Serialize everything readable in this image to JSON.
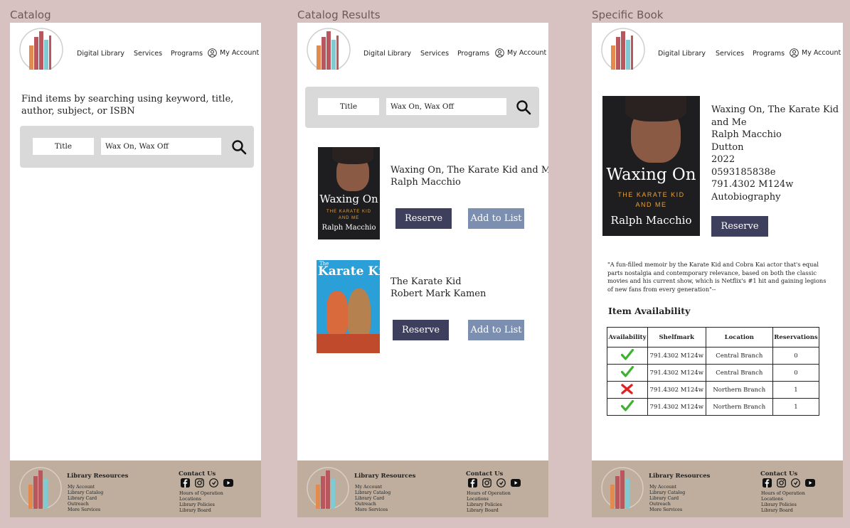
{
  "frames": {
    "catalog": "Catalog",
    "results": "Catalog Results",
    "book": "Specific Book"
  },
  "nav": {
    "digital_library": "Digital Library",
    "services": "Services",
    "programs": "Programs",
    "my_account": "My Account"
  },
  "search": {
    "intro": "Find items by searching using keyword, title, author, subject, or ISBN",
    "type": "Title",
    "query": "Wax On, Wax Off"
  },
  "results": [
    {
      "title": "Waxing On, The Karate Kid and Me",
      "author": "Ralph Macchio",
      "reserve": "Reserve",
      "add": "Add to List"
    },
    {
      "title": "The Karate Kid",
      "author": "Robert Mark Kamen",
      "reserve": "Reserve",
      "add": "Add to List"
    }
  ],
  "covers": {
    "waxing_title": "Waxing On",
    "waxing_sub1": "THE KARATE KID",
    "waxing_sub2": "AND ME",
    "waxing_author": "Ralph Macchio",
    "karate_the": "The",
    "karate_title": "Karate Kid"
  },
  "book": {
    "title_line1": "Waxing On, The Karate Kid",
    "title_line2": "and Me",
    "author": "Ralph Macchio",
    "publisher": "Dutton",
    "year": "2022",
    "isbn": "0593185838e",
    "call_number": "791.4302 M124w",
    "genre": "Autobiography",
    "reserve": "Reserve",
    "description": "\"A fun-filled memoir by the Karate Kid and Cobra Kai actor that's equal parts nostalgia and contemporary relevance, based on both the classic movies and his current show, which is Netflix's #1 hit and gaining legions of new fans from every generation\"--",
    "availability_heading": "Item Availability",
    "table": {
      "headers": [
        "Availability",
        "Shelfmark",
        "Location",
        "Reservations"
      ],
      "rows": [
        {
          "status": "available",
          "shelfmark": "791.4302 M124w",
          "location": "Central Branch",
          "reservations": "0"
        },
        {
          "status": "available",
          "shelfmark": "791.4302 M124w",
          "location": "Central Branch",
          "reservations": "0"
        },
        {
          "status": "unavailable",
          "shelfmark": "791.4302 M124w",
          "location": "Northern Branch",
          "reservations": "1"
        },
        {
          "status": "available",
          "shelfmark": "791.4302 M124w",
          "location": "Northern Branch",
          "reservations": "1"
        }
      ]
    }
  },
  "footer": {
    "resources_heading": "Library Resources",
    "resources": [
      "My Account",
      "Library Catalog",
      "Library Card",
      "Outreach",
      "More Services"
    ],
    "contact_heading": "Contact Us",
    "contact": [
      "Hours of Operation",
      "Locations",
      "Library Policies",
      "Library Board"
    ],
    "social_icons": [
      "facebook-icon",
      "instagram-icon",
      "pinterest-icon",
      "youtube-icon"
    ]
  },
  "colors": {
    "background": "#d8c1c1",
    "button_dark": "#3e3f5c",
    "button_light": "#7d8fb0",
    "footer": "#bfae9d",
    "search_panel": "#d9d9d9",
    "check": "#3bb32b",
    "cross": "#e32020"
  }
}
